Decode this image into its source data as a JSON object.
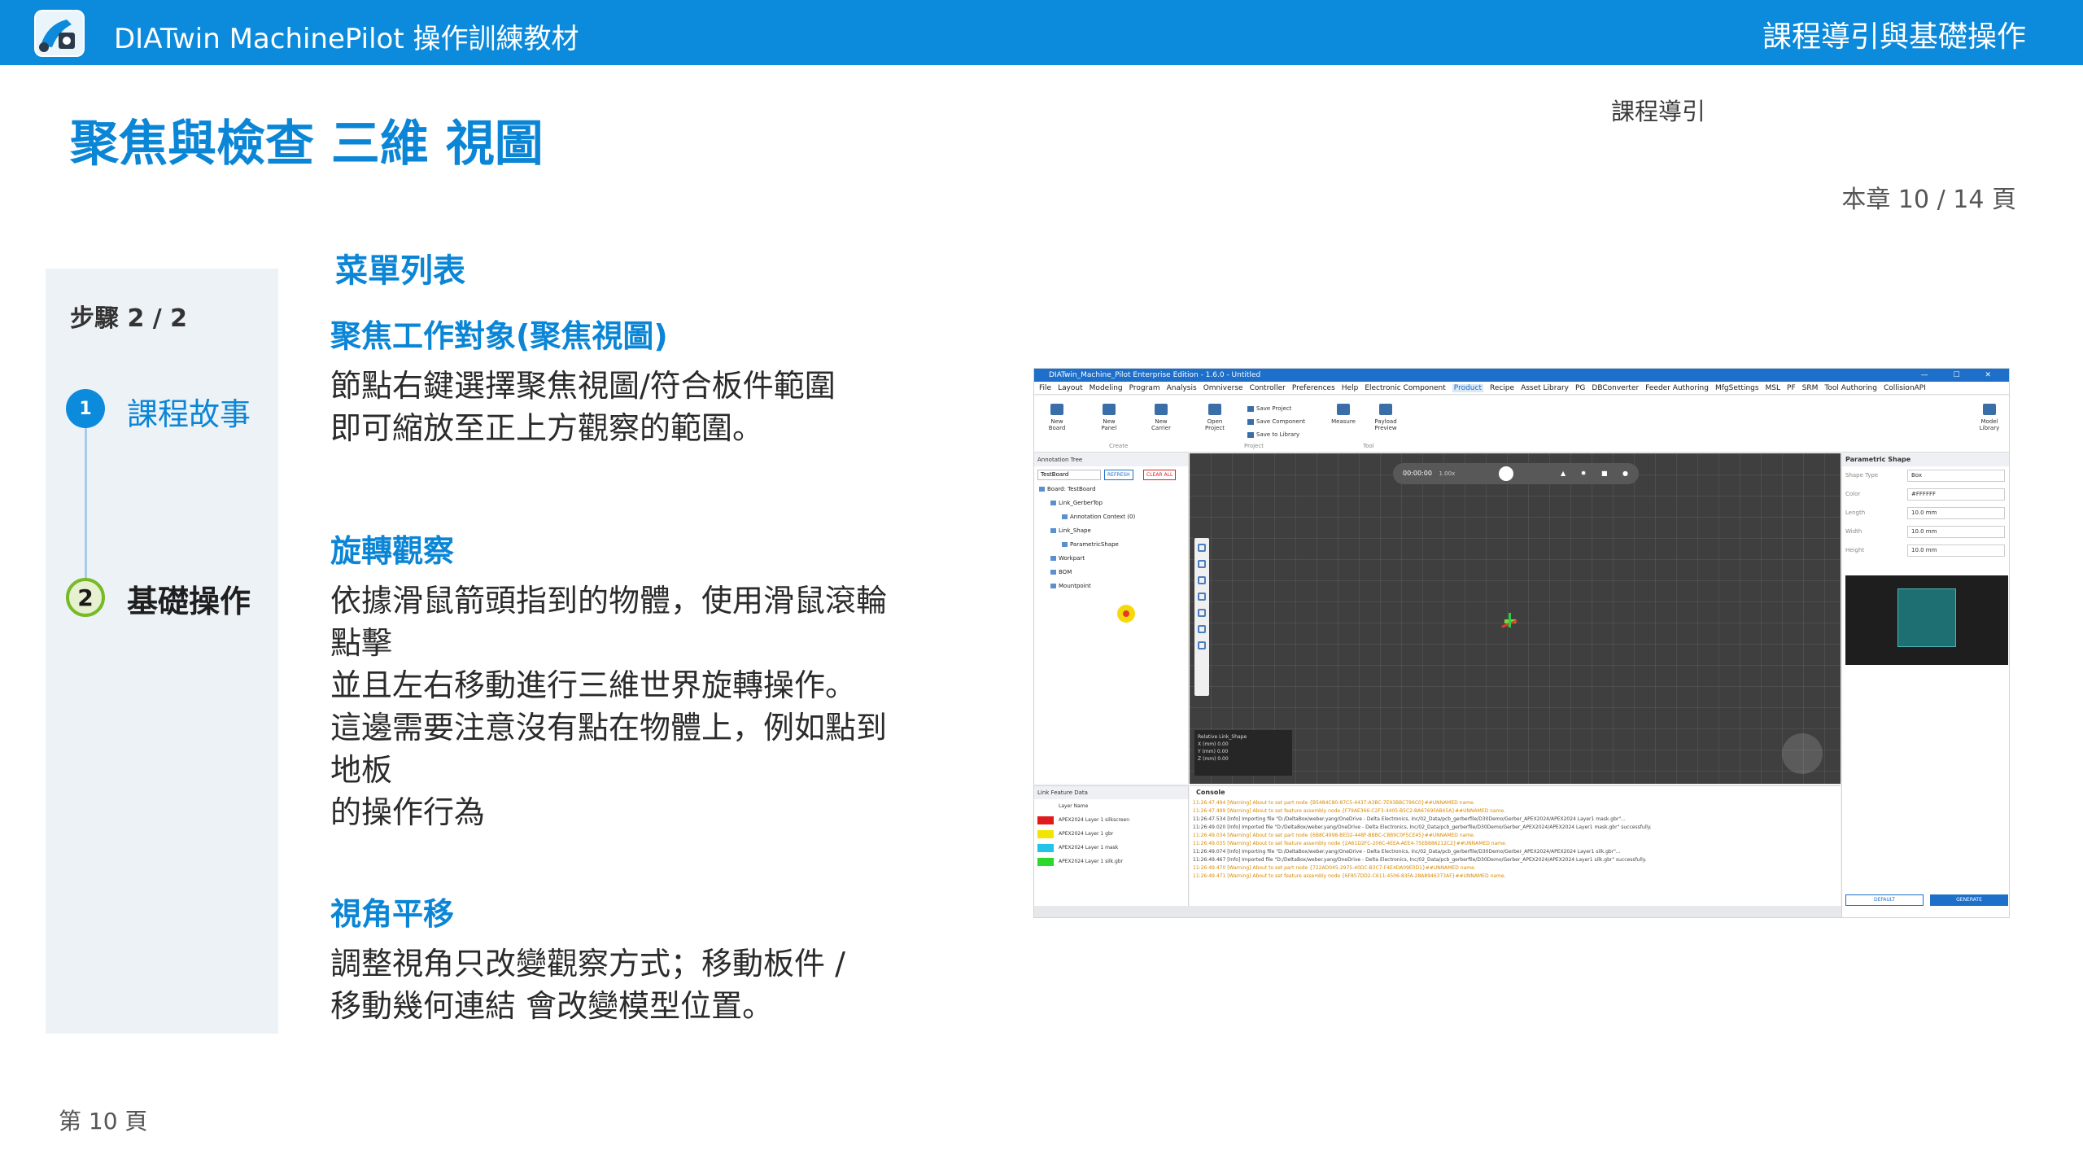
{
  "header": {
    "app_title": "DIATwin MachinePilot 操作訓練教材",
    "chapter_title": "課程導引與基礎操作"
  },
  "page": {
    "title": "聚焦與檢查 三維 視圖",
    "section_tag": "課程導引",
    "chapter_page": "本章 10 / 14 頁",
    "footer_page": "第 10 頁"
  },
  "steps": {
    "count_label": "步驟 2 / 2",
    "items": [
      {
        "num": "1",
        "label": "課程故事"
      },
      {
        "num": "2",
        "label": "基礎操作"
      }
    ]
  },
  "content": {
    "menu_heading": "菜單列表",
    "sections": [
      {
        "heading": "聚焦工作對象(聚焦視圖)",
        "lines": [
          "節點右鍵選擇聚焦視圖/符合板件範圍",
          "即可縮放至正上方觀察的範圍。"
        ]
      },
      {
        "heading": "旋轉觀察",
        "lines": [
          "依據滑鼠箭頭指到的物體，使用滑鼠滾輪",
          "點擊",
          "並且左右移動進行三維世界旋轉操作。",
          "這邊需要注意沒有點在物體上，例如點到",
          "地板",
          "的操作行為"
        ]
      },
      {
        "heading": "視角平移",
        "lines": [
          "調整視角只改變觀察方式；移動板件 /",
          "移動幾何連結 會改變模型位置。"
        ]
      }
    ]
  },
  "screenshot": {
    "window_title": "DIATwin_Machine_Pilot Enterprise Edition - 1.6.0 - Untitled",
    "window_controls": "— ☐ ✕",
    "menus": [
      "File",
      "Layout",
      "Modeling",
      "Program",
      "Analysis",
      "Omniverse",
      "Controller",
      "Preferences",
      "Help",
      "Electronic Component",
      "Product",
      "Recipe",
      "Asset Library",
      "PG",
      "DBConverter",
      "Feeder Authoring",
      "MfgSettings",
      "MSL",
      "PF",
      "SRM",
      "Tool Authoring",
      "CollisionAPI"
    ],
    "active_menu": "Product",
    "ribbon": {
      "new_board": "New Board",
      "new_panel": "New Panel",
      "new_carrier": "New Carrier",
      "create_group": "Create",
      "open_project": "Open Project",
      "save_project": "Save Project",
      "save_component": "Save Component",
      "save_to_library": "Save to Library",
      "project_group": "Project",
      "measure": "Measure",
      "payload_preview": "Payload Preview",
      "tool_group": "Tool",
      "model_library": "Model Library"
    },
    "annotation_tree": {
      "title": "Annotation Tree",
      "select_value": "TestBoard",
      "refresh": "REFRESH",
      "clear_all": "CLEAR ALL",
      "items": [
        "Board: TestBoard",
        "Link_GerberTop",
        "Annotation Context (0)",
        "Link_Shape",
        "ParametricShape",
        "Workpart",
        "BOM",
        "Mountpoint"
      ]
    },
    "viewport": {
      "time": "00:00:00",
      "speed": "1.00x",
      "info_title": "Relative Link_Shape",
      "info_rows": [
        "X (mm)  0.00",
        "Y (mm)  0.00",
        "Z (mm)  0.00"
      ]
    },
    "parametric_shape": {
      "title": "Parametric Shape",
      "rows": [
        {
          "label": "Shape Type",
          "value": "Box"
        },
        {
          "label": "Color",
          "value": "#FFFFFF"
        },
        {
          "label": "Length",
          "value": "10.0 mm"
        },
        {
          "label": "Width",
          "value": "10.0 mm"
        },
        {
          "label": "Height",
          "value": "10.0 mm"
        }
      ],
      "default_btn": "DEFAULT",
      "generate_btn": "GENERATE"
    },
    "link_feature": {
      "title": "Link Feature Data",
      "col": "Layer Name",
      "rows": [
        {
          "name": "APEX2024 Layer 1 silkscreen",
          "color": "#e01b1b"
        },
        {
          "name": "APEX2024 Layer 1 gbr",
          "color": "#f2e600"
        },
        {
          "name": "APEX2024 Layer 1 mask",
          "color": "#1fc4e8"
        },
        {
          "name": "APEX2024 Layer 1 silk.gbr",
          "color": "#2bd92b"
        }
      ]
    },
    "console": {
      "title": "Console",
      "lines": [
        {
          "t": "w",
          "text": "11:26:47.494 [Warning] About to set part node {B5484C80-87C5-4437-A3BC-7E93BBC796C0}##UNNAMED name."
        },
        {
          "t": "w",
          "text": "11:26:47.499 [Warning] About to set feature assembly node {F79AE366-C2F3-4405-B5C2-BA6769FAB45A}##UNNAMED name."
        },
        {
          "t": "i",
          "text": "11:26:47.534 [Info] Importing file \"D:/DeltaBox/weber.yang/OneDrive - Delta Electronics, Inc/02_Data/pcb_gerberfile/D30Demo/Gerber_APEX2024/APEX2024 Layer1 mask.gbr\"..."
        },
        {
          "t": "i",
          "text": "11:26:49.020 [Info] Imported file \"D:/DeltaBox/weber.yang/OneDrive - Delta Electronics, Inc/02_Data/pcb_gerberfile/D30Demo/Gerber_APEX2024/APEX2024 Layer1 mask.gbr\" successfully."
        },
        {
          "t": "w",
          "text": "11:26:49.034 [Warning] About to set part node {6B8C4998-BED2-448F-BBBC-C8B9C0F5CE45}##UNNAMED name."
        },
        {
          "t": "w",
          "text": "11:26:49.035 [Warning] About to set feature assembly node {2A61D2FC-206C-4EEA-AEE4-75EB886212C2}##UNNAMED name."
        },
        {
          "t": "i",
          "text": "11:26:49.074 [Info] Importing file \"D:/DeltaBox/weber.yang/OneDrive - Delta Electronics, Inc/02_Data/pcb_gerberfile/D30Demo/Gerber_APEX2024/APEX2024 Layer1 silk.gbr\"..."
        },
        {
          "t": "i",
          "text": "11:26:49.467 [Info] Imported file \"D:/DeltaBox/weber.yang/OneDrive - Delta Electronics, Inc/02_Data/pcb_gerberfile/D30Demo/Gerber_APEX2024/APEX2024 Layer1 silk.gbr\" successfully."
        },
        {
          "t": "w",
          "text": "11:26:49.470 [Warning] About to set part node {722AD045-2975-40DC-B3C7-F4E4DA09E0D1}##UNNAMED name."
        },
        {
          "t": "w",
          "text": "11:26:49.471 [Warning] About to set feature assembly node {6F857DD2-C611-4506-83FA-28A8946373AF}##UNNAMED name."
        }
      ]
    }
  }
}
